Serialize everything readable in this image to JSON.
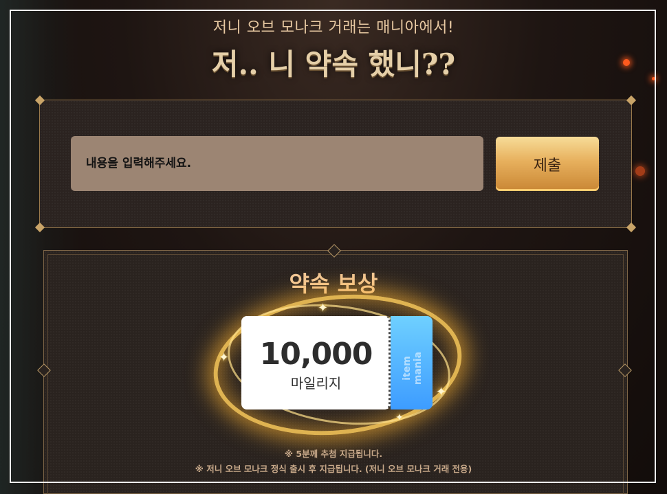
{
  "header": {
    "subtitle": "저니 오브 모나크 거래는 매니아에서!",
    "title": "저.. 니 약속 했니??"
  },
  "form": {
    "input_placeholder": "내용을 입력해주세요.",
    "input_value": "",
    "submit_label": "제출"
  },
  "reward": {
    "title": "약속 보상",
    "amount": "10,000",
    "unit": "마일리지",
    "stub_text": "item mania",
    "notes": [
      "※ 5분께 추첨 지급됩니다.",
      "※ 저니 오브 모나크 정식 출시 후 지급됩니다. (저니 오브 모나크 거래 전용)"
    ]
  },
  "colors": {
    "accent_gold": "#e7b05d",
    "coupon_stub_blue": "#3d9cff",
    "input_bg": "#9c8573"
  }
}
